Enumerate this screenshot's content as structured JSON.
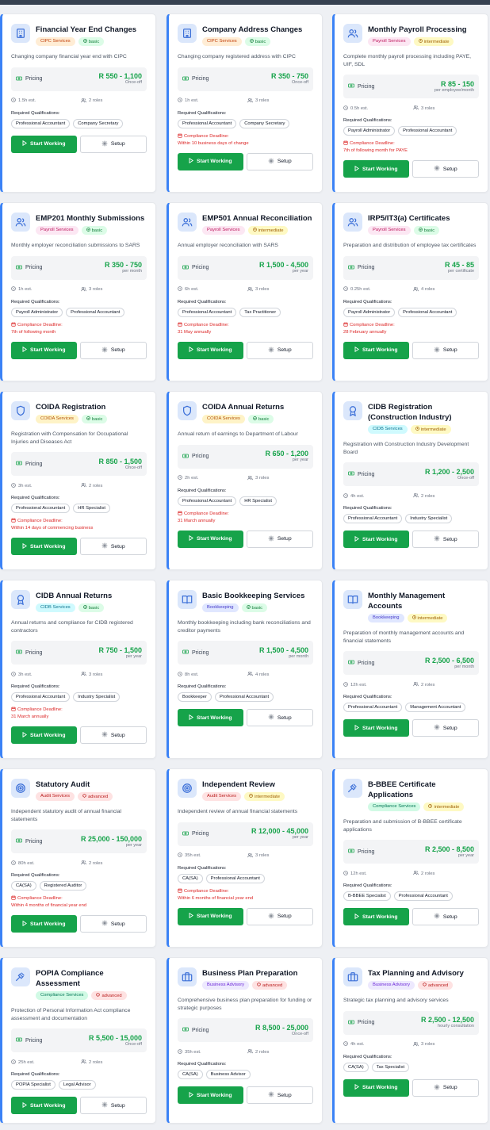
{
  "labels": {
    "pricing": "Pricing",
    "est_suffix": "est.",
    "roles_suffix": "roles",
    "required_qualifications": "Required Qualifications:",
    "compliance_deadline": "Compliance Deadline:",
    "start_working": "Start Working",
    "setup": "Setup"
  },
  "category_colors": {
    "CIPC Services": {
      "bg": "#ffedd5",
      "fg": "#c2410c"
    },
    "Payroll Services": {
      "bg": "#fce7f3",
      "fg": "#be185d"
    },
    "COIDA Services": {
      "bg": "#fef3c7",
      "fg": "#b45309"
    },
    "CIDB Services": {
      "bg": "#cffafe",
      "fg": "#0e7490"
    },
    "Bookkeeping": {
      "bg": "#e0e7ff",
      "fg": "#4338ca"
    },
    "Audit Services": {
      "bg": "#fee2e2",
      "fg": "#b91c1c"
    },
    "Compliance Services": {
      "bg": "#d1fae5",
      "fg": "#047857"
    },
    "Business Advisory": {
      "bg": "#ede9fe",
      "fg": "#6d28d9"
    }
  },
  "level_colors": {
    "basic": {
      "bg": "#dcfce7",
      "fg": "#15803d"
    },
    "intermediate": {
      "bg": "#fef9c3",
      "fg": "#a16207"
    },
    "advanced": {
      "bg": "#fee2e2",
      "fg": "#b91c1c"
    }
  },
  "services": [
    {
      "title": "Financial Year End Changes",
      "icon": "building-icon",
      "category": "CIPC Services",
      "level": "basic",
      "description": "Changing company financial year end with CIPC",
      "price": "R 550 - 1,100",
      "per": "Once-off",
      "hours": "1.5h",
      "roles": "2",
      "qualifications": [
        "Professional Accountant",
        "Company Secretary"
      ],
      "deadline": ""
    },
    {
      "title": "Company Address Changes",
      "icon": "building-icon",
      "category": "CIPC Services",
      "level": "basic",
      "description": "Changing company registered address with CIPC",
      "price": "R 350 - 750",
      "per": "Once-off",
      "hours": "1h",
      "roles": "3",
      "qualifications": [
        "Professional Accountant",
        "Company Secretary"
      ],
      "deadline": "Within 10 business days of change"
    },
    {
      "title": "Monthly Payroll Processing",
      "icon": "users-icon",
      "category": "Payroll Services",
      "level": "intermediate",
      "description": "Complete monthly payroll processing including PAYE, UIF, SDL",
      "price": "R 85 - 150",
      "per": "per employee/month",
      "hours": "0.5h",
      "roles": "3",
      "qualifications": [
        "Payroll Administrator",
        "Professional Accountant"
      ],
      "deadline": "7th of following month for PAYE"
    },
    {
      "title": "EMP201 Monthly Submissions",
      "icon": "users-icon",
      "category": "Payroll Services",
      "level": "basic",
      "description": "Monthly employer reconciliation submissions to SARS",
      "price": "R 350 - 750",
      "per": "per month",
      "hours": "1h",
      "roles": "3",
      "qualifications": [
        "Payroll Administrator",
        "Professional Accountant"
      ],
      "deadline": "7th of following month"
    },
    {
      "title": "EMP501 Annual Reconciliation",
      "icon": "users-icon",
      "category": "Payroll Services",
      "level": "intermediate",
      "description": "Annual employer reconciliation with SARS",
      "price": "R 1,500 - 4,500",
      "per": "per year",
      "hours": "6h",
      "roles": "3",
      "qualifications": [
        "Professional Accountant",
        "Tax Practitioner"
      ],
      "deadline": "31 May annually"
    },
    {
      "title": "IRP5/IT3(a) Certificates",
      "icon": "users-icon",
      "category": "Payroll Services",
      "level": "basic",
      "description": "Preparation and distribution of employee tax certificates",
      "price": "R 45 - 85",
      "per": "per certificate",
      "hours": "0.25h",
      "roles": "4",
      "qualifications": [
        "Payroll Administrator",
        "Professional Accountant"
      ],
      "deadline": "28 February annually"
    },
    {
      "title": "COIDA Registration",
      "icon": "shield-icon",
      "category": "COIDA Services",
      "level": "basic",
      "description": "Registration with Compensation for Occupational Injuries and Diseases Act",
      "price": "R 850 - 1,500",
      "per": "Once-off",
      "hours": "3h",
      "roles": "2",
      "qualifications": [
        "Professional Accountant",
        "HR Specialist"
      ],
      "deadline": "Within 14 days of commencing business"
    },
    {
      "title": "COIDA Annual Returns",
      "icon": "shield-icon",
      "category": "COIDA Services",
      "level": "basic",
      "description": "Annual return of earnings to Department of Labour",
      "price": "R 650 - 1,200",
      "per": "per year",
      "hours": "2h",
      "roles": "3",
      "qualifications": [
        "Professional Accountant",
        "HR Specialist"
      ],
      "deadline": "31 March annually"
    },
    {
      "title": "CIDB Registration (Construction Industry)",
      "icon": "award-icon",
      "category": "CIDB Services",
      "level": "intermediate",
      "description": "Registration with Construction Industry Development Board",
      "price": "R 1,200 - 2,500",
      "per": "Once-off",
      "hours": "4h",
      "roles": "2",
      "qualifications": [
        "Professional Accountant",
        "Industry Specialist"
      ],
      "deadline": ""
    },
    {
      "title": "CIDB Annual Returns",
      "icon": "award-icon",
      "category": "CIDB Services",
      "level": "basic",
      "description": "Annual returns and compliance for CIDB registered contractors",
      "price": "R 750 - 1,500",
      "per": "per year",
      "hours": "3h",
      "roles": "3",
      "qualifications": [
        "Professional Accountant",
        "Industry Specialist"
      ],
      "deadline": "31 March annually"
    },
    {
      "title": "Basic Bookkeeping Services",
      "icon": "book-icon",
      "category": "Bookkeeping",
      "level": "basic",
      "description": "Monthly bookkeeping including bank reconciliations and creditor payments",
      "price": "R 1,500 - 4,500",
      "per": "per month",
      "hours": "8h",
      "roles": "4",
      "qualifications": [
        "Bookkeeper",
        "Professional Accountant"
      ],
      "deadline": ""
    },
    {
      "title": "Monthly Management Accounts",
      "icon": "book-icon",
      "category": "Bookkeeping",
      "level": "intermediate",
      "description": "Preparation of monthly management accounts and financial statements",
      "price": "R 2,500 - 6,500",
      "per": "per month",
      "hours": "12h",
      "roles": "2",
      "qualifications": [
        "Professional Accountant",
        "Management Accountant"
      ],
      "deadline": ""
    },
    {
      "title": "Statutory Audit",
      "icon": "target-icon",
      "category": "Audit Services",
      "level": "advanced",
      "description": "Independent statutory audit of annual financial statements",
      "price": "R 25,000 - 150,000",
      "per": "per year",
      "hours": "80h",
      "roles": "2",
      "qualifications": [
        "CA(SA)",
        "Registered Auditor"
      ],
      "deadline": "Within 4 months of financial year end"
    },
    {
      "title": "Independent Review",
      "icon": "target-icon",
      "category": "Audit Services",
      "level": "intermediate",
      "description": "Independent review of annual financial statements",
      "price": "R 12,000 - 45,000",
      "per": "per year",
      "hours": "35h",
      "roles": "3",
      "qualifications": [
        "CA(SA)",
        "Professional Accountant"
      ],
      "deadline": "Within 6 months of financial year end"
    },
    {
      "title": "B-BBEE Certificate Applications",
      "icon": "gavel-icon",
      "category": "Compliance Services",
      "level": "intermediate",
      "description": "Preparation and submission of B-BBEE certificate applications",
      "price": "R 2,500 - 8,500",
      "per": "per year",
      "hours": "12h",
      "roles": "2",
      "qualifications": [
        "B-BBEE Specialist",
        "Professional Accountant"
      ],
      "deadline": ""
    },
    {
      "title": "POPIA Compliance Assessment",
      "icon": "gavel-icon",
      "category": "Compliance Services",
      "level": "advanced",
      "description": "Protection of Personal Information Act compliance assessment and documentation",
      "price": "R 5,500 - 15,000",
      "per": "Once-off",
      "hours": "25h",
      "roles": "2",
      "qualifications": [
        "POPIA Specialist",
        "Legal Advisor"
      ],
      "deadline": ""
    },
    {
      "title": "Business Plan Preparation",
      "icon": "briefcase-icon",
      "category": "Business Advisory",
      "level": "advanced",
      "description": "Comprehensive business plan preparation for funding or strategic purposes",
      "price": "R 8,500 - 25,000",
      "per": "Once-off",
      "hours": "35h",
      "roles": "2",
      "qualifications": [
        "CA(SA)",
        "Business Advisor"
      ],
      "deadline": ""
    },
    {
      "title": "Tax Planning and Advisory",
      "icon": "briefcase-icon",
      "category": "Business Advisory",
      "level": "advanced",
      "description": "Strategic tax planning and advisory services",
      "price": "R 2,500 - 12,500",
      "per": "hourly consultation",
      "hours": "4h",
      "roles": "3",
      "qualifications": [
        "CA(SA)",
        "Tax Specialist"
      ],
      "deadline": ""
    }
  ]
}
